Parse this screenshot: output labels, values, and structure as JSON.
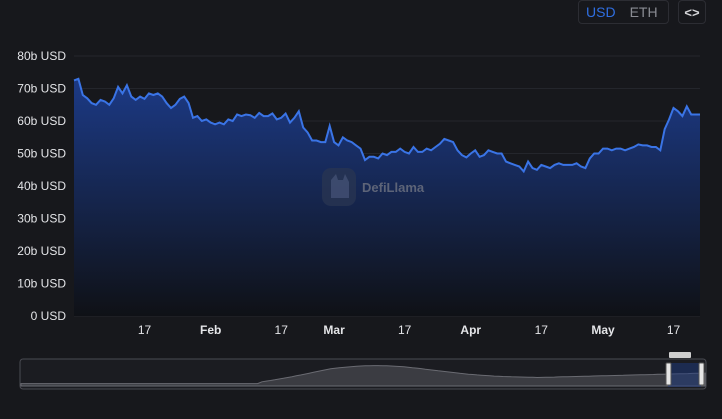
{
  "currency_toggle": {
    "options": [
      "USD",
      "ETH"
    ],
    "selected": "USD"
  },
  "embed_button": {
    "label": "<>",
    "icon": "code-icon"
  },
  "watermark": {
    "text": "DefiLlama",
    "icon": "llama-logo-icon"
  },
  "colors": {
    "line": "#3a74e6",
    "area_top": "#1c3a86",
    "area_bottom": "#0f1116",
    "background": "#17181c"
  },
  "chart_data": {
    "type": "area",
    "title": "",
    "xlabel": "",
    "ylabel": "",
    "unit": "USD",
    "ylim": [
      0,
      80
    ],
    "yticks": [
      "0 USD",
      "10b USD",
      "20b USD",
      "30b USD",
      "40b USD",
      "50b USD",
      "60b USD",
      "70b USD",
      "80b USD"
    ],
    "xticks": [
      {
        "day": 16,
        "label": "17",
        "month": false
      },
      {
        "day": 31,
        "label": "Feb",
        "month": true
      },
      {
        "day": 47,
        "label": "17",
        "month": false
      },
      {
        "day": 59,
        "label": "Mar",
        "month": true
      },
      {
        "day": 75,
        "label": "17",
        "month": false
      },
      {
        "day": 90,
        "label": "Apr",
        "month": true
      },
      {
        "day": 106,
        "label": "17",
        "month": false
      },
      {
        "day": 120,
        "label": "May",
        "month": true
      },
      {
        "day": 136,
        "label": "17",
        "month": false
      }
    ],
    "series": [
      {
        "values": [
          72.5,
          73.0,
          68.0,
          67.0,
          65.5,
          65.0,
          66.5,
          66.0,
          65.0,
          67.0,
          70.5,
          68.5,
          71.0,
          67.5,
          66.5,
          67.5,
          66.8,
          68.5,
          68.0,
          68.5,
          67.5,
          65.5,
          64.0,
          65.0,
          66.8,
          67.5,
          65.5,
          61.0,
          61.5,
          60.0,
          60.5,
          59.5,
          59.0,
          59.5,
          59.0,
          60.5,
          60.0,
          62.0,
          61.5,
          62.0,
          61.8,
          61.0,
          62.5,
          61.5,
          61.5,
          62.3,
          60.5,
          61.0,
          62.3,
          59.5,
          61.0,
          63.0,
          58.0,
          56.5,
          54.0,
          54.0,
          53.5,
          53.5,
          58.5,
          53.5,
          52.5,
          55.0,
          54.0,
          53.5,
          52.5,
          51.5,
          48.0,
          49.0,
          49.0,
          48.5,
          50.0,
          49.5,
          50.5,
          50.5,
          51.5,
          50.5,
          50.0,
          52.0,
          50.5,
          50.5,
          51.5,
          51.0,
          52.0,
          53.0,
          54.5,
          54.0,
          53.5,
          51.0,
          49.5,
          48.8,
          50.0,
          51.0,
          49.0,
          49.5,
          51.0,
          50.5,
          50.0,
          50.0,
          47.5,
          47.0,
          46.5,
          46.0,
          44.5,
          47.5,
          45.5,
          45.0,
          46.5,
          46.0,
          45.5,
          46.5,
          47.0,
          46.5,
          46.5,
          46.5,
          47.0,
          46.0,
          45.5,
          48.5,
          50.0,
          50.0,
          51.5,
          51.5,
          51.0,
          51.5,
          51.5,
          51.0,
          51.5,
          52.0,
          52.8,
          52.5,
          52.5,
          52.0,
          52.0,
          51.0,
          57.5,
          60.5,
          64.0,
          63.0,
          61.5,
          64.5,
          62.0,
          62.0,
          62.0
        ]
      }
    ]
  }
}
